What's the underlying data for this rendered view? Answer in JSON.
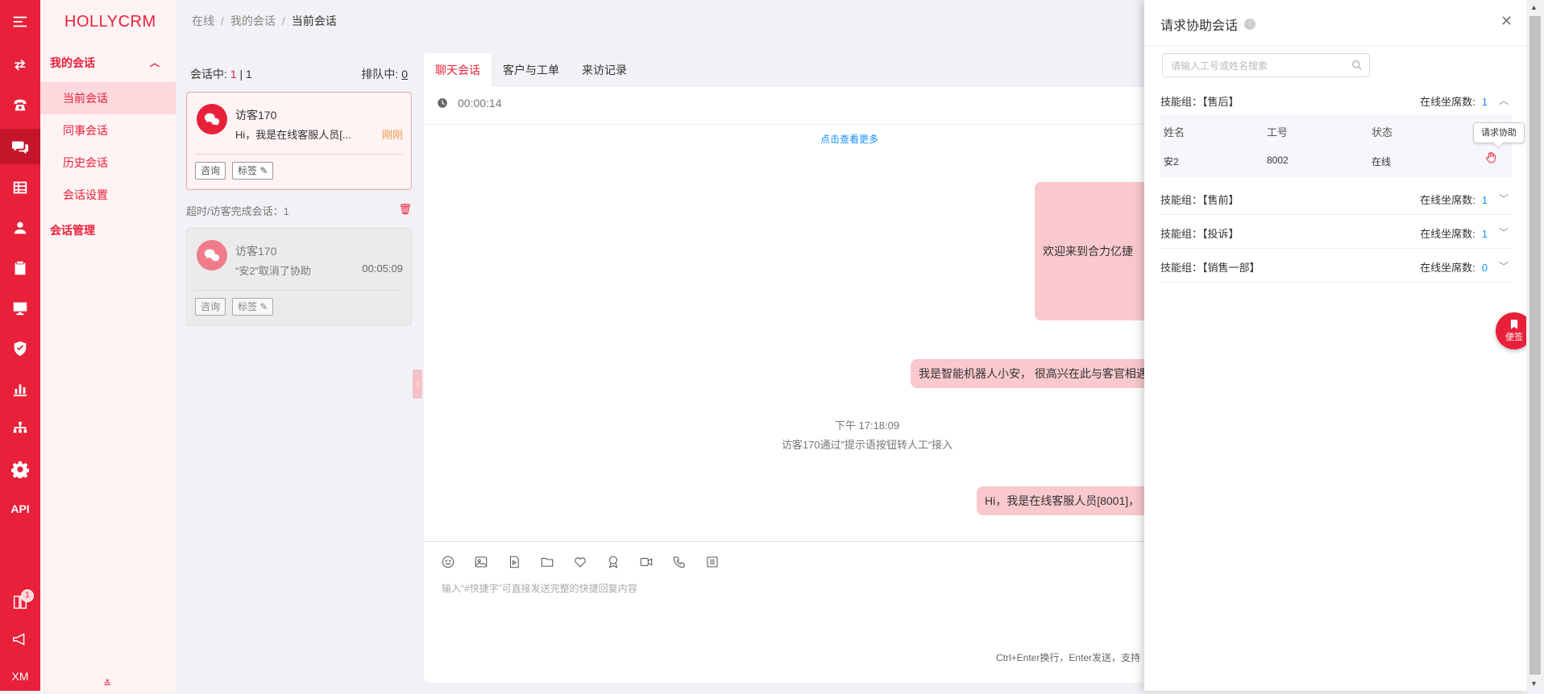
{
  "app": {
    "brand": "HOLLYCRM"
  },
  "rail": {
    "api_label": "API",
    "xm_label": "XM",
    "badge_count": "1"
  },
  "menu": {
    "group1": "我的会话",
    "items": [
      "当前会话",
      "同事会话",
      "历史会话",
      "会话设置"
    ],
    "group2": "会话管理"
  },
  "breadcrumb": [
    "在线",
    "我的会话",
    "当前会话"
  ],
  "sessions": {
    "active_label": "会话中:",
    "active_count": "1",
    "active_total": "| 1",
    "queue_label": "排队中:",
    "queue_count": "0",
    "current": {
      "name": "访客170",
      "message": "Hi，我是在线客服人员[...",
      "time": "刚刚",
      "btn1": "咨询",
      "btn2": "标签"
    },
    "timeout_label": "超时/访客完成会话：1",
    "done": {
      "name": "访客170",
      "message": "“安2”取消了协助",
      "time": "00:05:09",
      "btn1": "咨询",
      "btn2": "标签"
    }
  },
  "chat": {
    "tabs": [
      "聊天会话",
      "客户与工单",
      "来访记录"
    ],
    "timer": "00:00:14",
    "load_more": "点击查看更多",
    "messages": [
      "欢迎来到合力亿捷",
      "我是智能机器人小安， 很高兴在此与客官相遇",
      "Hi，我是在线客服人员[8001]，"
    ],
    "system_time": "下午 17:18:09",
    "system_note": "访客170通过”提示语按钮转人工“接入",
    "input_placeholder": "输入“#快捷字”可直接发送完整的快捷回复内容",
    "hint": "Ctrl+Enter换行，Enter发送，支持"
  },
  "drawer": {
    "title": "请求协助会话",
    "search_placeholder": "请输入工号或姓名搜索",
    "seats_label": "在线坐席数:",
    "groups": [
      {
        "label": "技能组：【售后】",
        "seats": "1"
      },
      {
        "label": "技能组：【售前】",
        "seats": "1"
      },
      {
        "label": "技能组：【投诉】",
        "seats": "1"
      },
      {
        "label": "技能组：【销售一部】",
        "seats": "0"
      }
    ],
    "table": {
      "headers": [
        "姓名",
        "工号",
        "状态"
      ],
      "row": [
        "安2",
        "8002",
        "在线"
      ]
    },
    "tooltip": "请求协助"
  },
  "sticky_note": "便签",
  "colors": {
    "primary": "#e8203a",
    "link": "#1890ff",
    "warn": "#f2994a"
  }
}
